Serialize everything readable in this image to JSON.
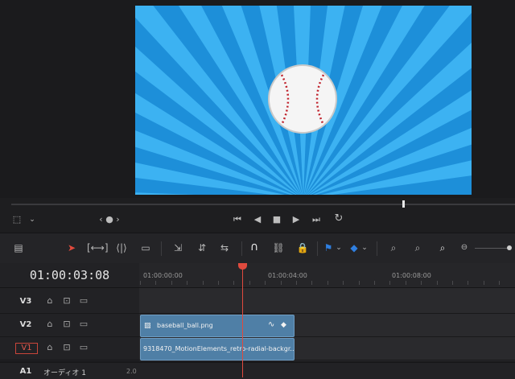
{
  "timeline": {
    "timecode": "01:00:03:08",
    "ruler_labels": [
      "01:00:00:00",
      "01:00:04:00",
      "01:00:08:00"
    ],
    "tracks": [
      {
        "id": "V3",
        "label": "V3"
      },
      {
        "id": "V2",
        "label": "V2"
      },
      {
        "id": "V1",
        "label": "V1"
      },
      {
        "id": "A1",
        "label": "A1",
        "name": "オーディオ 1",
        "channels": "2.0"
      }
    ],
    "clips": {
      "v2": {
        "name": "baseball_ball.png"
      },
      "v1": {
        "name": "9318470_MotionElements_retro-radial-backgr..."
      }
    }
  },
  "viewer": {
    "nav_icons": "‹ ● ›"
  },
  "colors": {
    "playhead": "#e04a3e",
    "clip": "#4f7fa6",
    "accent_blue": "#2f7fe0",
    "background": "#1e1e20"
  },
  "icons": [
    "crop-icon",
    "chevron-down-icon",
    "first-frame-icon",
    "play-reverse-icon",
    "stop-icon",
    "play-icon",
    "last-frame-icon",
    "loop-icon",
    "pointer-icon",
    "trim-icon",
    "blade-icon",
    "overwrite-icon",
    "snap-icon",
    "link-icon",
    "lock-icon",
    "flag-icon",
    "marker-icon",
    "zoom-icon"
  ]
}
